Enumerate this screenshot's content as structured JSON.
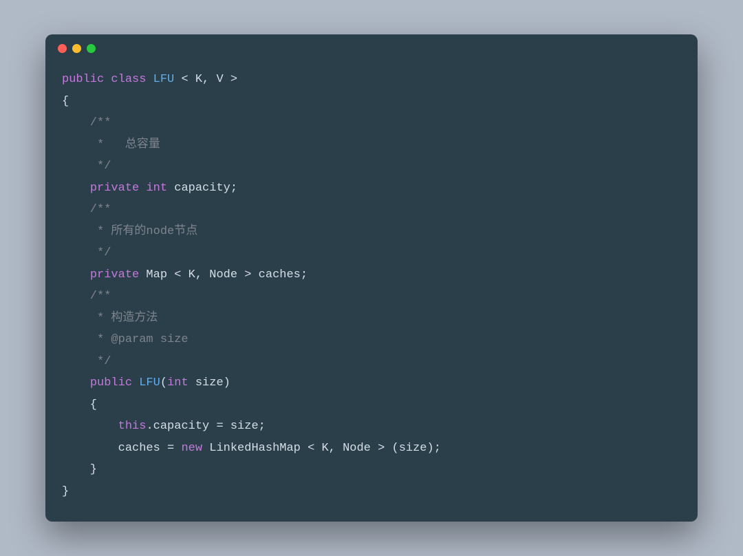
{
  "window": {
    "dots": [
      "red",
      "yellow",
      "green"
    ]
  },
  "code": {
    "l1_public": "public",
    "l1_class": "class",
    "l1_name": "LFU",
    "l1_gen": " < K, V >",
    "l2": "{",
    "l3": "    /**",
    "l4": "     *   总容量",
    "l5": "     */",
    "l6_ind": "    ",
    "l6_priv": "private",
    "l6_int": "int",
    "l6_rest": " capacity;",
    "l7": "    /**",
    "l8": "     * 所有的node节点",
    "l9": "     */",
    "l10_ind": "    ",
    "l10_priv": "private",
    "l10_rest": " Map < K, Node > caches;",
    "l11": "    /**",
    "l12": "     * 构造方法",
    "l13": "     * @param size",
    "l14": "     */",
    "l15_ind": "    ",
    "l15_pub": "public",
    "l15_name": " LFU",
    "l15_sig_open": "(",
    "l15_int": "int",
    "l15_sig_rest": " size)",
    "l16": "    {",
    "l17_ind": "        ",
    "l17_this": "this",
    "l17_rest": ".capacity = size;",
    "l18_ind": "        caches = ",
    "l18_new": "new",
    "l18_rest": " LinkedHashMap < K, Node > (size);",
    "l19": "    }",
    "l20": "}"
  }
}
